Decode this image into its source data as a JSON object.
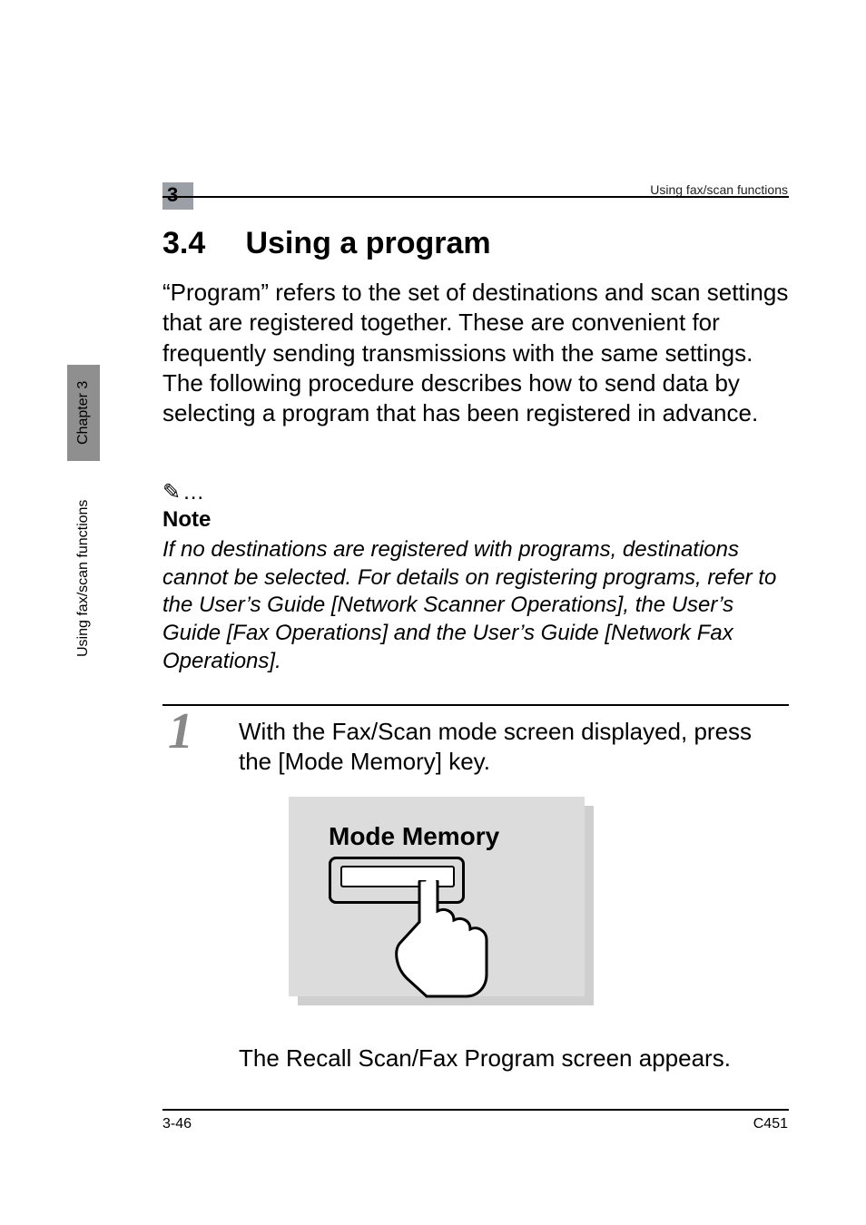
{
  "header": {
    "chapter_number": "3",
    "running_title": "Using fax/scan functions"
  },
  "sidebar": {
    "chapter_label": "Chapter 3",
    "section_label": "Using fax/scan functions"
  },
  "section": {
    "number": "3.4",
    "title": "Using a program"
  },
  "intro_paragraph": "“Program” refers to the set of destinations and scan settings that are registered together. These are convenient for frequently sending transmissions with the same settings. The following procedure describes how to send data by selecting a program that has been registered in advance.",
  "note": {
    "symbol": "✎…",
    "label": "Note",
    "text": "If no destinations are registered with programs, destinations cannot be selected. For details on registering programs, refer to the User’s Guide [Network Scanner Operations], the User’s Guide [Fax Operations] and the User’s Guide [Network Fax Operations]."
  },
  "step1": {
    "number": "1",
    "text": "With the Fax/Scan mode screen displayed, press the [Mode Memory] key."
  },
  "illustration": {
    "button_label": "Mode Memory"
  },
  "post_illustration_text": "The Recall Scan/Fax Program screen appears.",
  "footer": {
    "left": "3-46",
    "right": "C451"
  }
}
